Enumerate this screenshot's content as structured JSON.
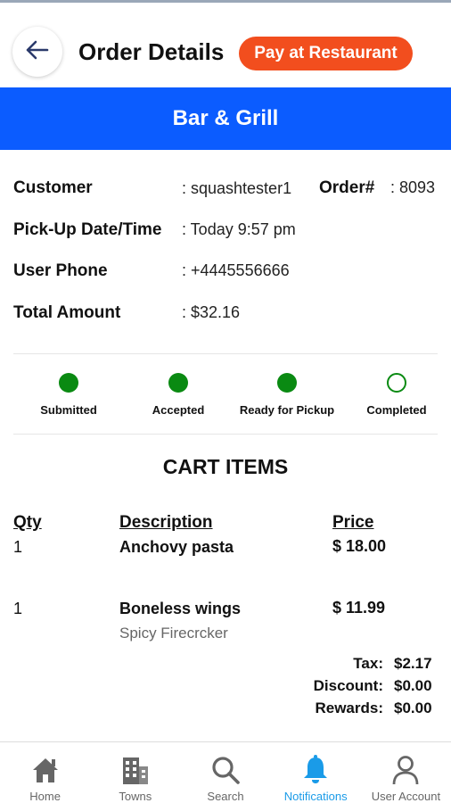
{
  "header": {
    "back_icon": "arrow-left-icon",
    "title": "Order Details",
    "payment_badge": "Pay at Restaurant"
  },
  "restaurant": {
    "name": "Bar & Grill"
  },
  "order_info": {
    "customer_label": "Customer",
    "customer_value": ": squashtester1",
    "order_label": "Order#",
    "order_value": ": 8093",
    "pickup_label": "Pick-Up Date/Time",
    "pickup_value": ": Today 9:57 pm",
    "phone_label": "User Phone",
    "phone_value": ": +4445556666",
    "total_label": "Total Amount",
    "total_value": ": $32.16"
  },
  "status_steps": [
    {
      "label": "Submitted",
      "done": true
    },
    {
      "label": "Accepted",
      "done": true
    },
    {
      "label": "Ready for Pickup",
      "done": true
    },
    {
      "label": "Completed",
      "done": false
    }
  ],
  "cart": {
    "title": "CART ITEMS",
    "headers": {
      "qty": "Qty",
      "description": "Description",
      "price": "Price"
    },
    "items": [
      {
        "qty": "1",
        "description": "Anchovy pasta",
        "note": "",
        "price": "$ 18.00"
      },
      {
        "qty": "1",
        "description": "Boneless wings",
        "note": "Spicy Firecrcker",
        "price": "$ 11.99"
      }
    ]
  },
  "totals": {
    "tax_label": "Tax:",
    "tax_value": "$2.17",
    "discount_label": "Discount:",
    "discount_value": "$0.00",
    "rewards_label": "Rewards:",
    "rewards_value": "$0.00"
  },
  "tabbar": {
    "active": "Notifications",
    "colors": {
      "active": "#1a9be8",
      "inactive": "#666666"
    },
    "items": [
      {
        "label": "Home",
        "icon": "home-icon"
      },
      {
        "label": "Towns",
        "icon": "buildings-icon"
      },
      {
        "label": "Search",
        "icon": "search-icon"
      },
      {
        "label": "Notifications",
        "icon": "bell-icon"
      },
      {
        "label": "User Account",
        "icon": "user-icon"
      }
    ]
  },
  "colors": {
    "banner": "#0b5cff",
    "badge": "#f24e1e",
    "status_green": "#0a8a12"
  }
}
